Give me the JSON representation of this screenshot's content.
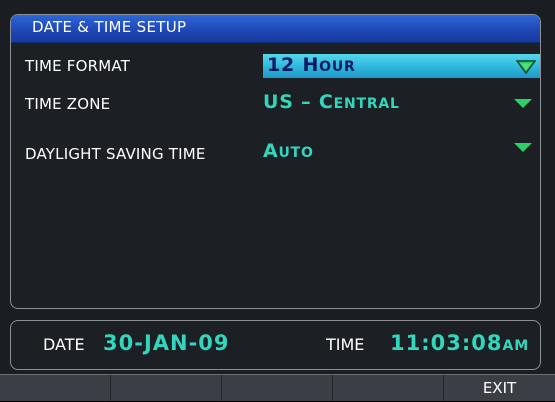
{
  "panel": {
    "title": "DATE & TIME SETUP",
    "rows": [
      {
        "label": "TIME FORMAT",
        "value_main": "12 H",
        "value_sc": "OUR",
        "selected": true
      },
      {
        "label": "TIME ZONE",
        "value_main": "US – C",
        "value_sc": "ENTRAL",
        "selected": false
      },
      {
        "label": "DAYLIGHT SAVING TIME",
        "value_main": "A",
        "value_sc": "UTO",
        "selected": false
      }
    ]
  },
  "status": {
    "date_label": "DATE",
    "date_value": "30-JAN-09",
    "time_label": "TIME",
    "time_value": "11:03:08",
    "time_suffix": "AM"
  },
  "softkeys": [
    "",
    "",
    "",
    "",
    "EXIT"
  ],
  "colors": {
    "accent_cyan": "#33d6bd",
    "selected_bg": "#2eb6dc",
    "title_bar": "#1e46b4",
    "dropdown_arrow": "#2dd064"
  }
}
